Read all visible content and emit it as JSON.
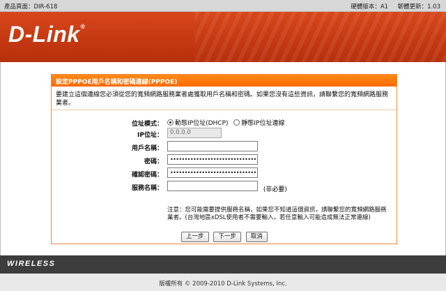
{
  "topbar": {
    "product_page": "產品頁面：DIR-618",
    "hw_version": "硬體版本：A1",
    "fw_version": "韌體更新：1.03"
  },
  "brand": {
    "logo": "D-Link",
    "mark": "®",
    "footer_brand": "WIRELESS"
  },
  "panel": {
    "title": "設定PPPOE用戶名稱和密碼連線(PPPOE)",
    "description": "要建立這個連線您必須從您的寬頻網路服務業者處獲取用戶名稱和密碼。如果您沒有這些資訊，請聯繫您的寬頻網路服務業者。"
  },
  "form": {
    "address_mode_label": "位址模式：",
    "dhcp_option": "動態IP位址(DHCP)",
    "static_option": "靜態IP位址連線",
    "ip_label": "IP位址：",
    "ip_value": "0.0.0.0",
    "username_label": "用戶名稱：",
    "username_value": "",
    "password_label": "密碼：",
    "password_value": "••••••••••••••••••••••••••••••••",
    "confirm_label": "確認密碼：",
    "confirm_value": "••••••••••••••••••••••••••••••••",
    "service_label": "服務名稱：",
    "service_value": "",
    "optional": "(非必要)",
    "note": "注意：您可能需要提供服務名稱，如果您不知道這個資訊，請聯繫您的寬頻網路服務業者。(台灣地區xDSL使用者不需要輸入，若任意輸入可能造成無法正常連線)"
  },
  "buttons": {
    "prev": "上一步",
    "next": "下一步",
    "cancel": "取消"
  },
  "footer": {
    "copyright": "版權所有 © 2009-2010 D-Link Systems, Inc."
  },
  "colors": {
    "accent": "#ff6a00",
    "banner": "#c53912",
    "wireless_bar": "#3d3d3d"
  }
}
